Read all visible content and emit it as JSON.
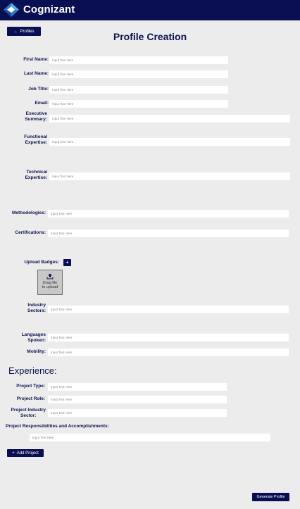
{
  "header": {
    "brand": "Cognizant",
    "logo_icon": "cognizant-logo"
  },
  "nav": {
    "back_label": "Profiles"
  },
  "page": {
    "title": "Profile Creation"
  },
  "placeholder": "Input Text Here",
  "fields": {
    "first_name": "First Name:",
    "last_name": "Last Name:",
    "job_title": "Job Title:",
    "email": "Email:",
    "exec_summary_1": "Executive",
    "exec_summary_2": "Summary:",
    "functional_1": "Functional",
    "functional_2": "Expertise:",
    "technical_1": "Technical",
    "technical_2": "Expertise:",
    "methodologies": "Methodologies:",
    "certifications": "Certifications:",
    "upload_badges": "Upload Badges:",
    "drop_line1": "Drag file",
    "drop_line2": "to upload",
    "industry_1": "Industry",
    "industry_2": "Sectors:",
    "languages_1": "Languages",
    "languages_2": "Spoken:",
    "mobility": "Mobility:"
  },
  "experience": {
    "heading": "Experience:",
    "project_type": "Project Type:",
    "project_role": "Project Role:",
    "project_industry_1": "Project Industry",
    "project_industry_2": "Sector:",
    "responsibilities": "Project Responsibilities and Accomplishments:",
    "add_project": "Add Project"
  },
  "actions": {
    "generate": "Generate Profile"
  },
  "colors": {
    "navy": "#0a0e52",
    "background": "#ececec",
    "input": "#ffffff"
  }
}
